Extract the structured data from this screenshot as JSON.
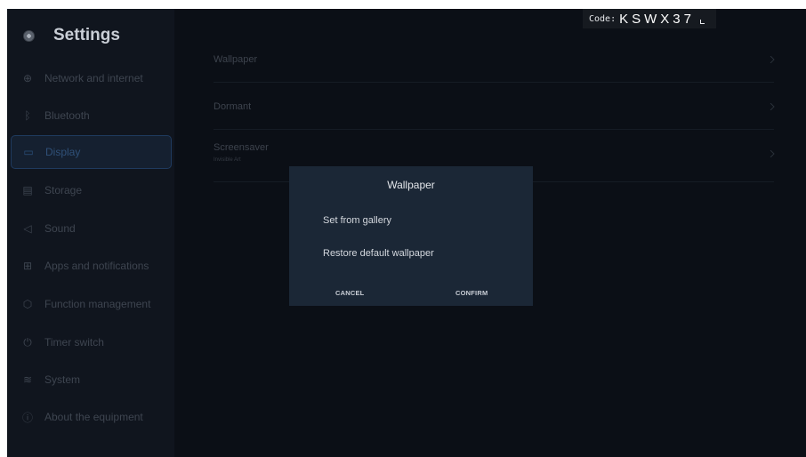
{
  "header": {
    "title": "Settings",
    "logo_icon": "settings-logo-icon"
  },
  "sidebar": {
    "items": [
      {
        "label": "Network and internet",
        "icon": "globe-icon",
        "glyph": "⊕"
      },
      {
        "label": "Bluetooth",
        "icon": "bluetooth-icon",
        "glyph": "ᛒ"
      },
      {
        "label": "Display",
        "icon": "monitor-icon",
        "glyph": "▭"
      },
      {
        "label": "Storage",
        "icon": "storage-icon",
        "glyph": "▤"
      },
      {
        "label": "Sound",
        "icon": "speaker-icon",
        "glyph": "◁"
      },
      {
        "label": "Apps and notifications",
        "icon": "apps-grid-icon",
        "glyph": "⊞"
      },
      {
        "label": "Function management",
        "icon": "cube-icon",
        "glyph": "⬡"
      },
      {
        "label": "Timer switch",
        "icon": "power-icon",
        "glyph": "⏻"
      },
      {
        "label": "System",
        "icon": "sliders-icon",
        "glyph": "≋"
      },
      {
        "label": "About the equipment",
        "icon": "info-icon",
        "glyph": "ⓘ"
      }
    ],
    "active_index": 2
  },
  "display_settings": {
    "rows": [
      {
        "label": "Wallpaper"
      },
      {
        "label": "Dormant"
      },
      {
        "label": "Screensaver",
        "sub": "Invisible Art"
      }
    ]
  },
  "code_badge": {
    "label": "Code:",
    "value": "KSWX37"
  },
  "dialog": {
    "title": "Wallpaper",
    "options": [
      "Set from gallery",
      "Restore default wallpaper"
    ],
    "cancel_label": "CANCEL",
    "confirm_label": "CONFIRM"
  },
  "colors": {
    "background": "#0b0f16",
    "sidebar": "#10151e",
    "dialog": "#1b2736",
    "active_item_border": "#1f3a5e"
  }
}
